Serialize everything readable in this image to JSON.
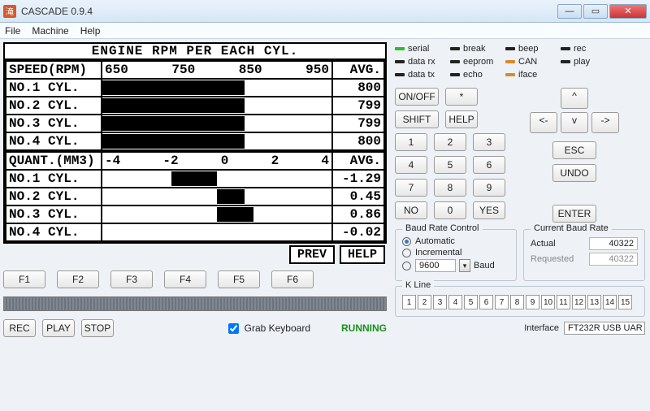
{
  "window": {
    "title": "CASCADE 0.9.4",
    "icon_glyph": "滝"
  },
  "menu": {
    "file": "File",
    "machine": "Machine",
    "help": "Help"
  },
  "lcd": {
    "title": "ENGINE RPM PER EACH CYL.",
    "rpm": {
      "axis_label": "SPEED(RPM)",
      "ticks": [
        "650",
        "750",
        "850",
        "950"
      ],
      "avg_label": "AVG.",
      "rows": [
        {
          "label": "NO.1 CYL.",
          "bar_left_pct": 0,
          "bar_width_pct": 62,
          "value": "800"
        },
        {
          "label": "NO.2 CYL.",
          "bar_left_pct": 0,
          "bar_width_pct": 62,
          "value": "799"
        },
        {
          "label": "NO.3 CYL.",
          "bar_left_pct": 0,
          "bar_width_pct": 62,
          "value": "799"
        },
        {
          "label": "NO.4 CYL.",
          "bar_left_pct": 0,
          "bar_width_pct": 62,
          "value": "800"
        }
      ]
    },
    "quant": {
      "axis_label": "QUANT.(MM3)",
      "ticks": [
        "-4",
        "-2",
        "0",
        "2",
        "4"
      ],
      "avg_label": "AVG.",
      "rows": [
        {
          "label": "NO.1 CYL.",
          "bar_left_pct": 30,
          "bar_width_pct": 20,
          "value": "-1.29"
        },
        {
          "label": "NO.2 CYL.",
          "bar_left_pct": 50,
          "bar_width_pct": 12,
          "value": "0.45"
        },
        {
          "label": "NO.3 CYL.",
          "bar_left_pct": 50,
          "bar_width_pct": 16,
          "value": "0.86"
        },
        {
          "label": "NO.4 CYL.",
          "bar_left_pct": 0,
          "bar_width_pct": 0,
          "value": "-0.02"
        }
      ]
    },
    "soft": {
      "prev": "PREV",
      "help": "HELP"
    }
  },
  "fkeys": [
    "F1",
    "F2",
    "F3",
    "F4",
    "F5",
    "F6"
  ],
  "rec": {
    "rec": "REC",
    "play": "PLAY",
    "stop": "STOP",
    "grab": "Grab Keyboard",
    "grab_checked": true,
    "status": "RUNNING"
  },
  "legend": [
    {
      "name": "serial",
      "color": "#2bbd2b"
    },
    {
      "name": "break",
      "color": "#222"
    },
    {
      "name": "beep",
      "color": "#222"
    },
    {
      "name": "rec",
      "color": "#222"
    },
    {
      "name": "data rx",
      "color": "#222"
    },
    {
      "name": "eeprom",
      "color": "#222"
    },
    {
      "name": "CAN",
      "color": "#d98a2b"
    },
    {
      "name": "play",
      "color": "#222"
    },
    {
      "name": "data tx",
      "color": "#222"
    },
    {
      "name": "echo",
      "color": "#222"
    },
    {
      "name": "iface",
      "color": "#d98a2b"
    }
  ],
  "keys": {
    "onoff": "ON/OFF",
    "star": "*",
    "shift": "SHIFT",
    "help": "HELP",
    "n1": "1",
    "n2": "2",
    "n3": "3",
    "n4": "4",
    "n5": "5",
    "n6": "6",
    "n7": "7",
    "n8": "8",
    "n9": "9",
    "n0": "0",
    "no": "NO",
    "yes": "YES",
    "esc": "ESC",
    "undo": "UNDO",
    "enter": "ENTER",
    "left": "<-",
    "right": "->",
    "up": "^",
    "down": "v"
  },
  "baud_ctrl": {
    "title": "Baud Rate Control",
    "automatic": "Automatic",
    "incremental": "Incremental",
    "value": "9600",
    "unit": "Baud",
    "selected": "Automatic"
  },
  "baud_rate": {
    "title": "Current Baud Rate",
    "actual_label": "Actual",
    "actual": "40322",
    "requested_label": "Requested",
    "requested": "40322"
  },
  "kline": {
    "title": "K Line",
    "cells": [
      "1",
      "2",
      "3",
      "4",
      "5",
      "6",
      "7",
      "8",
      "9",
      "10",
      "11",
      "12",
      "13",
      "14",
      "15"
    ]
  },
  "iface": {
    "label": "Interface",
    "value": "FT232R USB UAR"
  }
}
